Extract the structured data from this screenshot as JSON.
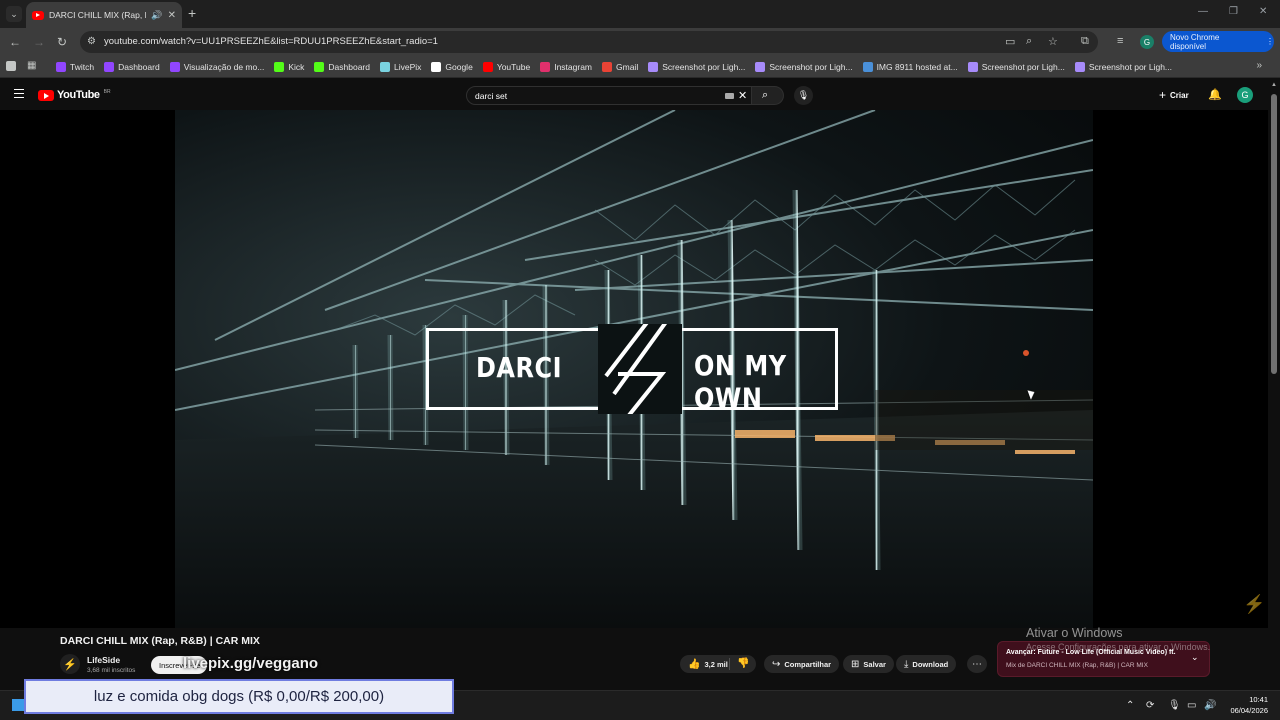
{
  "browser": {
    "tab": {
      "title": "DARCI CHILL MIX (Rap, R&B)",
      "audio_icon": "speaker-icon"
    },
    "url": "youtube.com/watch?v=UU1PRSEEZhE&list=RDUU1PRSEEZhE&start_radio=1",
    "update_label": "Novo Chrome disponível",
    "profile_initial": "G",
    "bookmarks": [
      {
        "label": "Twitch",
        "color": "#9146ff"
      },
      {
        "label": "Dashboard",
        "color": "#9146ff"
      },
      {
        "label": "Visualização de mo...",
        "color": "#9146ff"
      },
      {
        "label": "Kick",
        "color": "#53fc18"
      },
      {
        "label": "Dashboard",
        "color": "#53fc18"
      },
      {
        "label": "LivePix",
        "color": "#7ad3e0"
      },
      {
        "label": "Google",
        "color": "#ffffff"
      },
      {
        "label": "YouTube",
        "color": "#ff0000"
      },
      {
        "label": "Instagram",
        "color": "#e1306c"
      },
      {
        "label": "Gmail",
        "color": "#ea4335"
      },
      {
        "label": "Screenshot por Ligh...",
        "color": "#a78bfa"
      },
      {
        "label": "Screenshot por Ligh...",
        "color": "#a78bfa"
      },
      {
        "label": "IMG 8911 hosted at...",
        "color": "#4a90d9"
      },
      {
        "label": "Screenshot por Ligh...",
        "color": "#a78bfa"
      },
      {
        "label": "Screenshot por Ligh...",
        "color": "#a78bfa"
      }
    ]
  },
  "youtube": {
    "logo_text": "YouTube",
    "logo_region": "BR",
    "search_value": "darci set",
    "create_label": "Criar",
    "avatar_initial": "G"
  },
  "video": {
    "overlay_left": "DARCI",
    "overlay_right": "ON MY OWN",
    "title": "DARCI CHILL MIX (Rap, R&B) | CAR MIX",
    "channel_name": "LifeSide",
    "subscribers": "3,68 mil inscritos",
    "subscribe_label": "Inscrever-se",
    "stream_url_overlay": "livepix.gg/veggano",
    "like_count": "3,2 mil",
    "share_label": "Compartilhar",
    "save_label": "Salvar",
    "download_label": "Download",
    "next_up": {
      "title": "Avançar: Future - Low Life (Official Music Video) ft.",
      "subtitle": "Mix de DARCI CHILL MIX (Rap, R&B) | CAR MIX"
    }
  },
  "windows": {
    "activate_title": "Ativar o Windows",
    "activate_sub": "Acesse Configurações para ativar o Windows.",
    "time": "10:41",
    "date": "06/04/2026"
  },
  "donation_bar": "luz e comida obg dogs (R$ 0,00/R$ 200,00)"
}
